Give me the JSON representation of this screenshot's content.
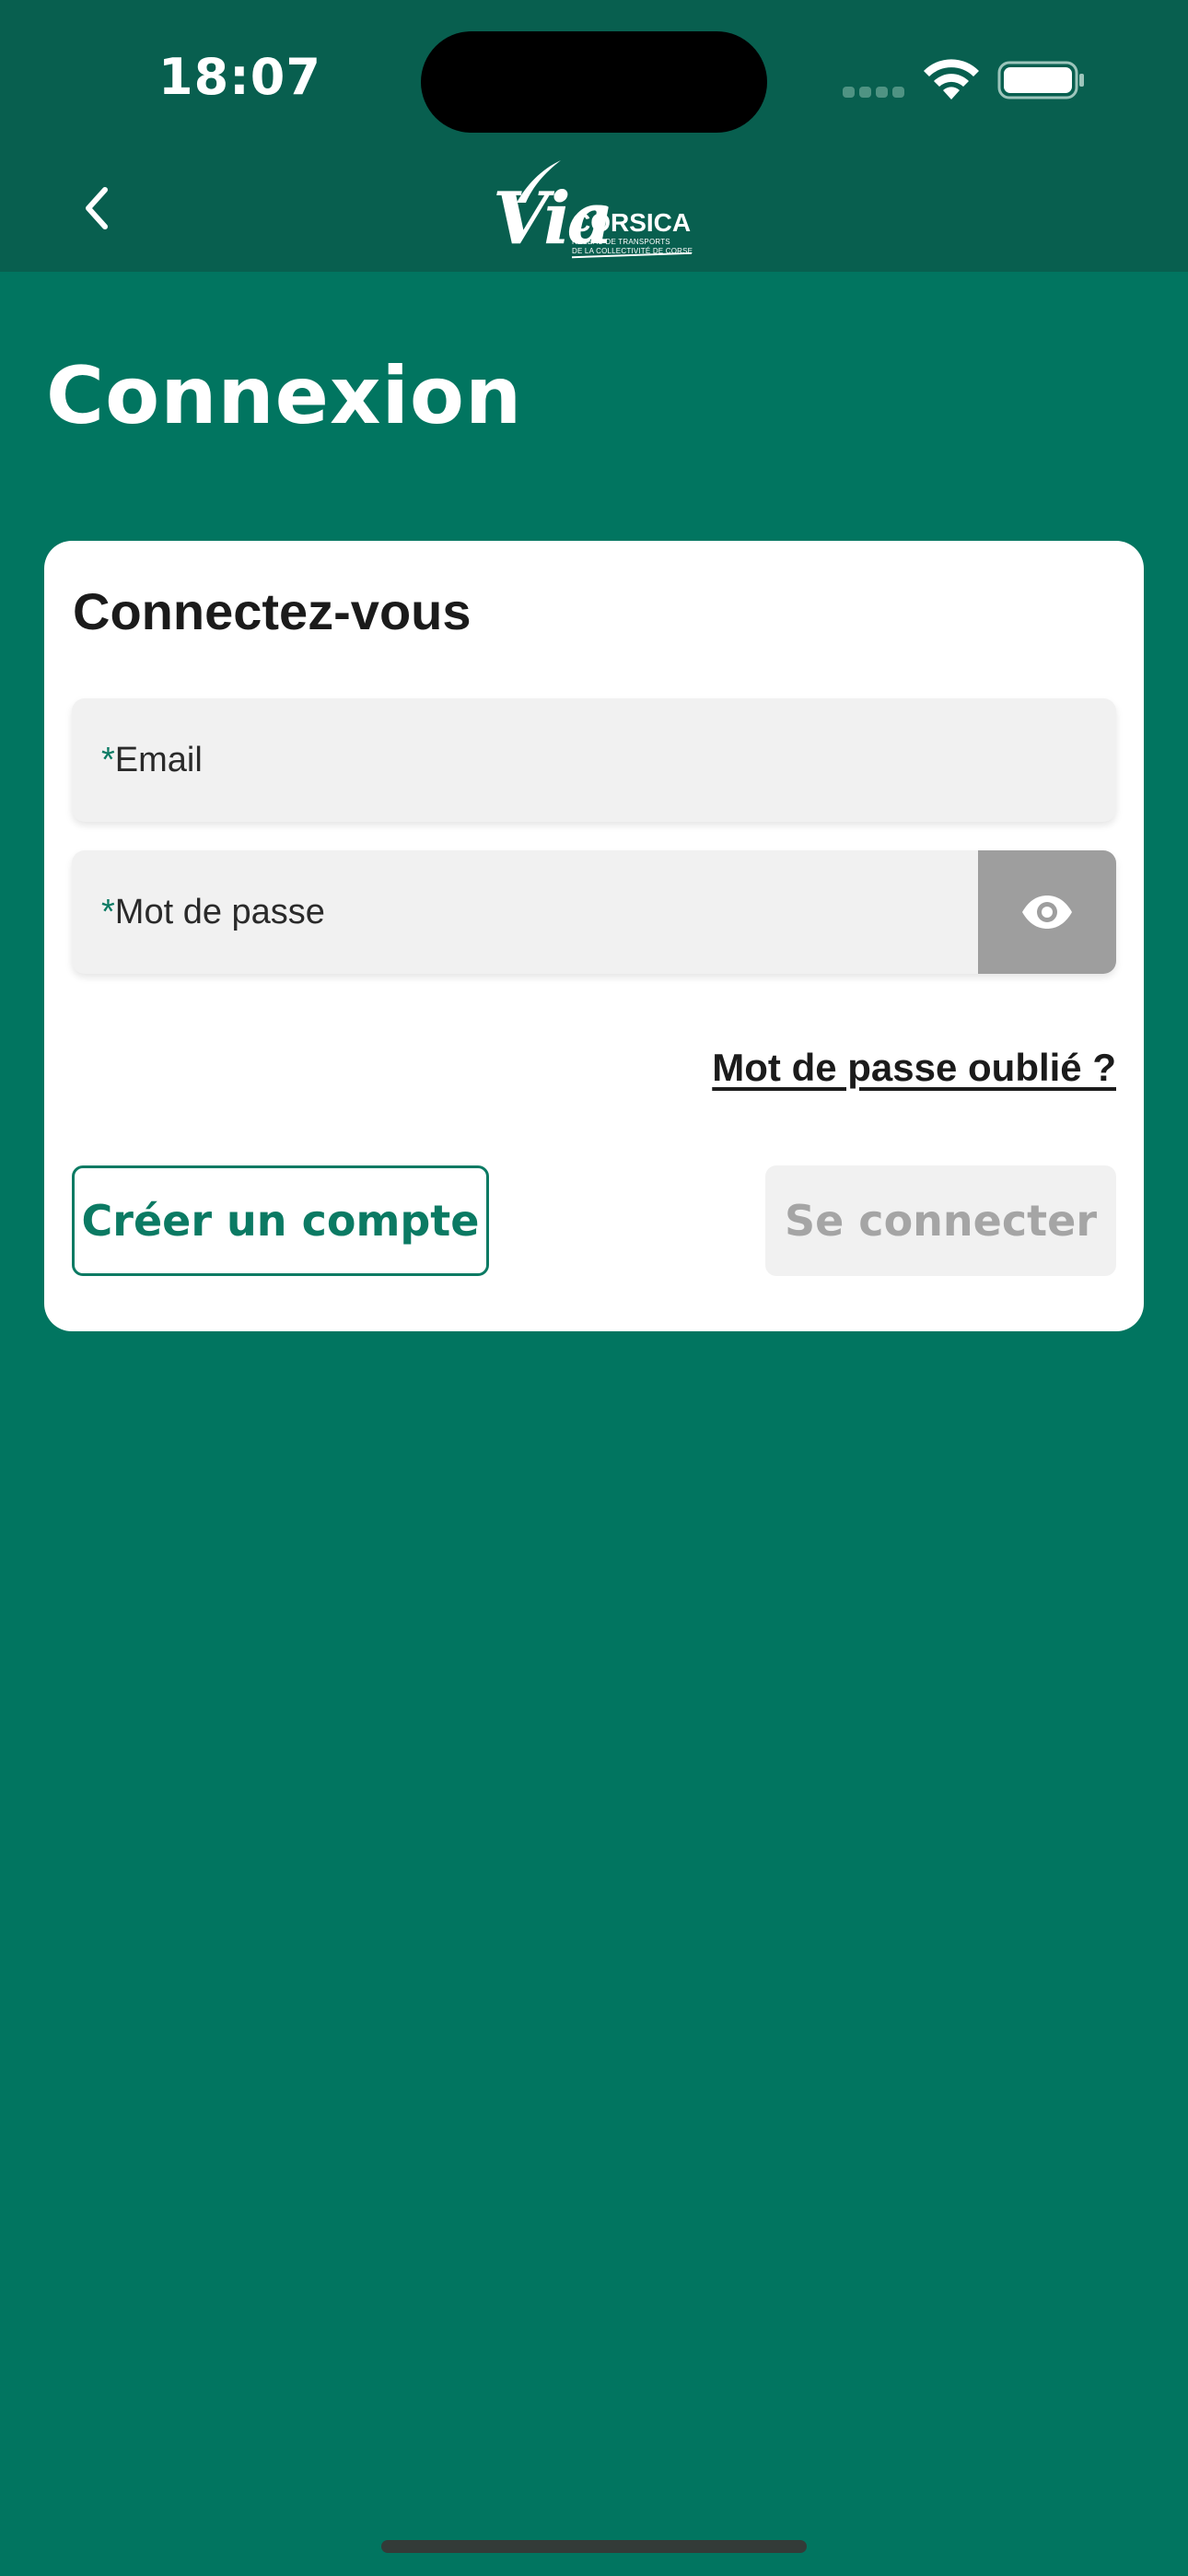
{
  "status_bar": {
    "time": "18:07",
    "icons": [
      "cellular-signal-icon",
      "wifi-icon",
      "battery-icon"
    ]
  },
  "header": {
    "back_icon": "chevron-left-icon",
    "logo": {
      "main": "Via",
      "brand": "CORSICA",
      "tagline_line1": "RÉSEAU DE TRANSPORTS",
      "tagline_line2": "DE LA COLLECTIVITÉ DE CORSE"
    }
  },
  "page": {
    "title": "Connexion"
  },
  "login_card": {
    "title": "Connectez-vous",
    "email_field": {
      "required_mark": "*",
      "label": "Email",
      "value": ""
    },
    "password_field": {
      "required_mark": "*",
      "label": "Mot de passe",
      "value": "",
      "toggle_icon": "eye-icon"
    },
    "forgot_password_link": "Mot de passe oublié ?",
    "create_account_button": "Créer un compte",
    "login_button": "Se connecter"
  },
  "colors": {
    "background": "#017560",
    "header": "#085f4f",
    "accent": "#0b7a63",
    "card": "#ffffff",
    "field": "#f1f1f1",
    "disabled_text": "#a5a5a5"
  }
}
